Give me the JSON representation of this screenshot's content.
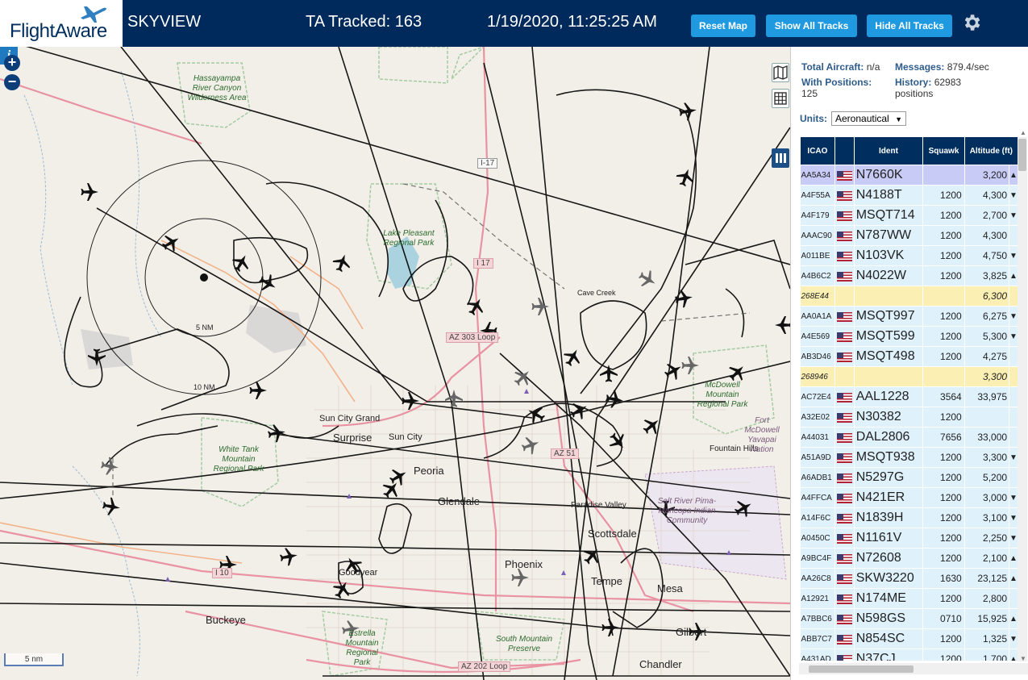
{
  "header": {
    "logo_text": "FlightAware",
    "site_name": "SKYVIEW",
    "ta_tracked": "TA Tracked: 163",
    "datetime": "1/19/2020, 11:25:25 AM",
    "buttons": {
      "reset": "Reset Map",
      "show": "Show All Tracks",
      "hide": "Hide All Tracks"
    },
    "settings_icon": "gear-icon"
  },
  "colors": {
    "header_bg": "#012a5c",
    "button_bg": "#1f9ae0",
    "table_header_bg": "#002f5f",
    "row_bg": "#dff1fb",
    "row_selected_bg": "#c7cbf5",
    "row_no_position_bg": "#fbefb3"
  },
  "map": {
    "zoom_in": "+",
    "zoom_out": "−",
    "scale_label": "5 nm",
    "info_icon": "i",
    "ring_labels": {
      "r5": "5 NM",
      "r10": "10 NM"
    },
    "places": {
      "surprise": "Surprise",
      "sun_city": "Sun City",
      "sun_city_grand": "Sun City Grand",
      "peoria": "Peoria",
      "glendale": "Glendale",
      "phoenix": "Phoenix",
      "scottsdale": "Scottsdale",
      "paradise_valley": "Paradise Valley",
      "tempe": "Tempe",
      "mesa": "Mesa",
      "gilbert": "Gilbert",
      "chandler": "Chandler",
      "buckeye": "Buckeye",
      "goodyear": "Goodyear",
      "fountain_hills": "Fountain Hills",
      "cave_creek": "Cave Creek"
    },
    "parks": {
      "hassayampa": "Hassayampa River Canyon Wilderness Area",
      "lake_pleasant": "Lake Pleasant Regional Park",
      "white_tank": "White Tank Mountain Regional Park",
      "mcdowell": "McDowell Mountain Regional Park",
      "fort_mcdowell": "Fort McDowell Yavapai Nation",
      "salt_river": "Salt River Pima-Maricopa Indian Community",
      "estrella": "Estrella Mountain Regional Park",
      "south_mountain": "South Mountain Preserve"
    },
    "roads": {
      "i17_a": "I-17",
      "i17_b": "I 17",
      "az303": "AZ 303 Loop",
      "az51": "AZ 51",
      "i10": "I 10",
      "az202": "AZ 202 Loop"
    }
  },
  "sidebar": {
    "stats": {
      "total_label": "Total Aircraft:",
      "total_value": "n/a",
      "messages_label": "Messages:",
      "messages_value": "879.4/sec",
      "with_pos_label": "With Positions:",
      "with_pos_value": "125",
      "history_label": "History:",
      "history_value": "62983 positions"
    },
    "units_label": "Units:",
    "units_value": "Aeronautical",
    "columns": [
      "ICAO",
      "",
      "Ident",
      "Squawk",
      "Altitude (ft)"
    ],
    "rows": [
      {
        "icao": "AA5A34",
        "flag": "us-flag-icon",
        "ident": "N7660K",
        "squawk": "",
        "altitude": "3,200",
        "trend": "▲",
        "state": "selected"
      },
      {
        "icao": "A4F55A",
        "flag": "us-flag-icon",
        "ident": "N4188T",
        "squawk": "1200",
        "altitude": "4,300",
        "trend": "▼",
        "state": ""
      },
      {
        "icao": "A4F179",
        "flag": "us-flag-icon",
        "ident": "MSQT714",
        "squawk": "1200",
        "altitude": "2,700",
        "trend": "▼",
        "state": ""
      },
      {
        "icao": "AAAC90",
        "flag": "us-flag-icon",
        "ident": "N787WW",
        "squawk": "1200",
        "altitude": "4,300",
        "trend": "",
        "state": ""
      },
      {
        "icao": "A011BE",
        "flag": "us-flag-icon",
        "ident": "N103VK",
        "squawk": "1200",
        "altitude": "4,750",
        "trend": "▼",
        "state": ""
      },
      {
        "icao": "A4B6C2",
        "flag": "us-flag-icon",
        "ident": "N4022W",
        "squawk": "1200",
        "altitude": "3,825",
        "trend": "▲",
        "state": ""
      },
      {
        "icao": "268E44",
        "flag": "",
        "ident": "",
        "squawk": "",
        "altitude": "6,300",
        "trend": "",
        "state": "no-pos"
      },
      {
        "icao": "AA0A1A",
        "flag": "us-flag-icon",
        "ident": "MSQT997",
        "squawk": "1200",
        "altitude": "6,275",
        "trend": "▼",
        "state": ""
      },
      {
        "icao": "A4E569",
        "flag": "us-flag-icon",
        "ident": "MSQT599",
        "squawk": "1200",
        "altitude": "5,300",
        "trend": "▼",
        "state": ""
      },
      {
        "icao": "AB3D46",
        "flag": "us-flag-icon",
        "ident": "MSQT498",
        "squawk": "1200",
        "altitude": "4,275",
        "trend": "",
        "state": ""
      },
      {
        "icao": "268946",
        "flag": "",
        "ident": "",
        "squawk": "",
        "altitude": "3,300",
        "trend": "",
        "state": "no-pos"
      },
      {
        "icao": "AC72E4",
        "flag": "us-flag-icon",
        "ident": "AAL1228",
        "squawk": "3564",
        "altitude": "33,975",
        "trend": "",
        "state": ""
      },
      {
        "icao": "A32E02",
        "flag": "us-flag-icon",
        "ident": "N30382",
        "squawk": "1200",
        "altitude": "",
        "trend": "",
        "state": ""
      },
      {
        "icao": "A44031",
        "flag": "us-flag-icon",
        "ident": "DAL2806",
        "squawk": "7656",
        "altitude": "33,000",
        "trend": "",
        "state": ""
      },
      {
        "icao": "A51A9D",
        "flag": "us-flag-icon",
        "ident": "MSQT938",
        "squawk": "1200",
        "altitude": "3,300",
        "trend": "▼",
        "state": ""
      },
      {
        "icao": "A6ADB1",
        "flag": "us-flag-icon",
        "ident": "N5297G",
        "squawk": "1200",
        "altitude": "5,200",
        "trend": "",
        "state": ""
      },
      {
        "icao": "A4FFCA",
        "flag": "us-flag-icon",
        "ident": "N421ER",
        "squawk": "1200",
        "altitude": "3,000",
        "trend": "▼",
        "state": ""
      },
      {
        "icao": "A14F6C",
        "flag": "us-flag-icon",
        "ident": "N1839H",
        "squawk": "1200",
        "altitude": "3,100",
        "trend": "▼",
        "state": ""
      },
      {
        "icao": "A0450C",
        "flag": "us-flag-icon",
        "ident": "N1161V",
        "squawk": "1200",
        "altitude": "2,250",
        "trend": "▼",
        "state": ""
      },
      {
        "icao": "A9BC4F",
        "flag": "us-flag-icon",
        "ident": "N72608",
        "squawk": "1200",
        "altitude": "2,100",
        "trend": "▲",
        "state": ""
      },
      {
        "icao": "AA26C8",
        "flag": "us-flag-icon",
        "ident": "SKW3220",
        "squawk": "1630",
        "altitude": "23,125",
        "trend": "▲",
        "state": ""
      },
      {
        "icao": "A12921",
        "flag": "us-flag-icon",
        "ident": "N174ME",
        "squawk": "1200",
        "altitude": "2,800",
        "trend": "",
        "state": ""
      },
      {
        "icao": "A7BBC6",
        "flag": "us-flag-icon",
        "ident": "N598GS",
        "squawk": "0710",
        "altitude": "15,925",
        "trend": "▲",
        "state": ""
      },
      {
        "icao": "ABB7C7",
        "flag": "us-flag-icon",
        "ident": "N854SC",
        "squawk": "1200",
        "altitude": "1,325",
        "trend": "▼",
        "state": ""
      },
      {
        "icao": "A431AD",
        "flag": "us-flag-icon",
        "ident": "N37CJ",
        "squawk": "1200",
        "altitude": "1,700",
        "trend": "▲",
        "state": ""
      }
    ]
  }
}
